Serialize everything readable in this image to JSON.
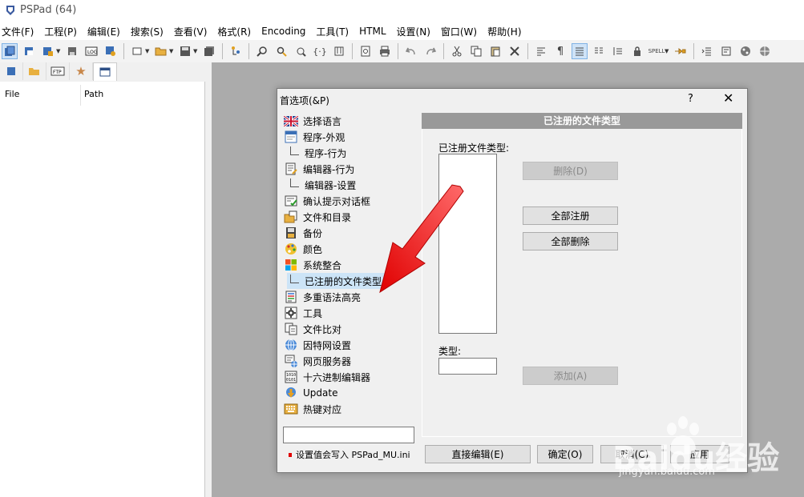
{
  "window": {
    "title": "PSPad (64)"
  },
  "menu": [
    "文件(F)",
    "工程(P)",
    "编辑(E)",
    "搜索(S)",
    "查看(V)",
    "格式(R)",
    "Encoding",
    "工具(T)",
    "HTML",
    "设置(N)",
    "窗口(W)",
    "帮助(H)"
  ],
  "left_panel": {
    "col_file": "File",
    "col_path": "Path"
  },
  "dialog": {
    "title": "首选项(&P)",
    "help": "?",
    "close": "✕",
    "tree": [
      {
        "label": "选择语言",
        "icon": "uk-flag-icon"
      },
      {
        "label": "程序-外观",
        "icon": "window-icon"
      },
      {
        "label": "程序-行为",
        "child": true
      },
      {
        "label": "编辑器-行为",
        "icon": "edit-doc-icon"
      },
      {
        "label": "编辑器-设置",
        "child": true
      },
      {
        "label": "确认提示对话框",
        "icon": "confirm-icon"
      },
      {
        "label": "文件和目录",
        "icon": "folder-file-icon"
      },
      {
        "label": "备份",
        "icon": "backup-icon"
      },
      {
        "label": "颜色",
        "icon": "palette-icon"
      },
      {
        "label": "系统整合",
        "icon": "windows-logo-icon"
      },
      {
        "label": "已注册的文件类型",
        "child": true,
        "selected": true
      },
      {
        "label": "多重语法高亮",
        "icon": "syntax-icon"
      },
      {
        "label": "工具",
        "icon": "gear-icon"
      },
      {
        "label": "文件比对",
        "icon": "compare-icon"
      },
      {
        "label": "因特网设置",
        "icon": "globe-icon"
      },
      {
        "label": "网页服务器",
        "icon": "web-server-icon"
      },
      {
        "label": "十六进制编辑器",
        "icon": "hex-icon"
      },
      {
        "label": "Update",
        "icon": "update-icon"
      },
      {
        "label": "热键对应",
        "icon": "keyboard-icon"
      }
    ],
    "note": "设置值会写入 PSPad_MU.ini",
    "section_header": "已注册的文件类型",
    "registered_label": "已注册文件类型:",
    "type_label": "类型:",
    "buttons": {
      "delete": "删除(D)",
      "register_all": "全部注册",
      "delete_all": "全部删除",
      "add": "添加(A)",
      "direct_edit": "直接编辑(E)",
      "ok": "确定(O)",
      "cancel": "取消(C)",
      "apply": "应用"
    }
  },
  "watermark": {
    "brand": "Baidu经验",
    "url": "jingyan.baidu.com"
  }
}
